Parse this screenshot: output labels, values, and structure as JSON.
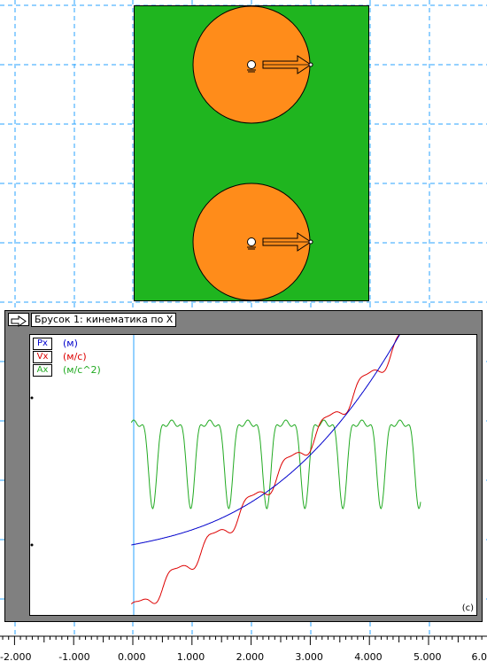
{
  "panel": {
    "title": "Брусок 1: кинематика по X",
    "unit_label": "(с)",
    "legend": [
      {
        "code": "Px",
        "unit": "(м)",
        "color": "#0000cc"
      },
      {
        "code": "Vx",
        "unit": "(м/с)",
        "color": "#dd0000"
      },
      {
        "code": "Ax",
        "unit": "(м/с^2)",
        "color": "#22aa22"
      }
    ]
  },
  "axis": {
    "tick_labels": [
      "-2.000",
      "-1.000",
      "0.000",
      "1.000",
      "2.000",
      "3.000",
      "4.000",
      "5.000",
      "6.0"
    ]
  },
  "scene": {
    "block_color": "#1fb51f",
    "wheel_color": "#ff8c1a"
  }
}
